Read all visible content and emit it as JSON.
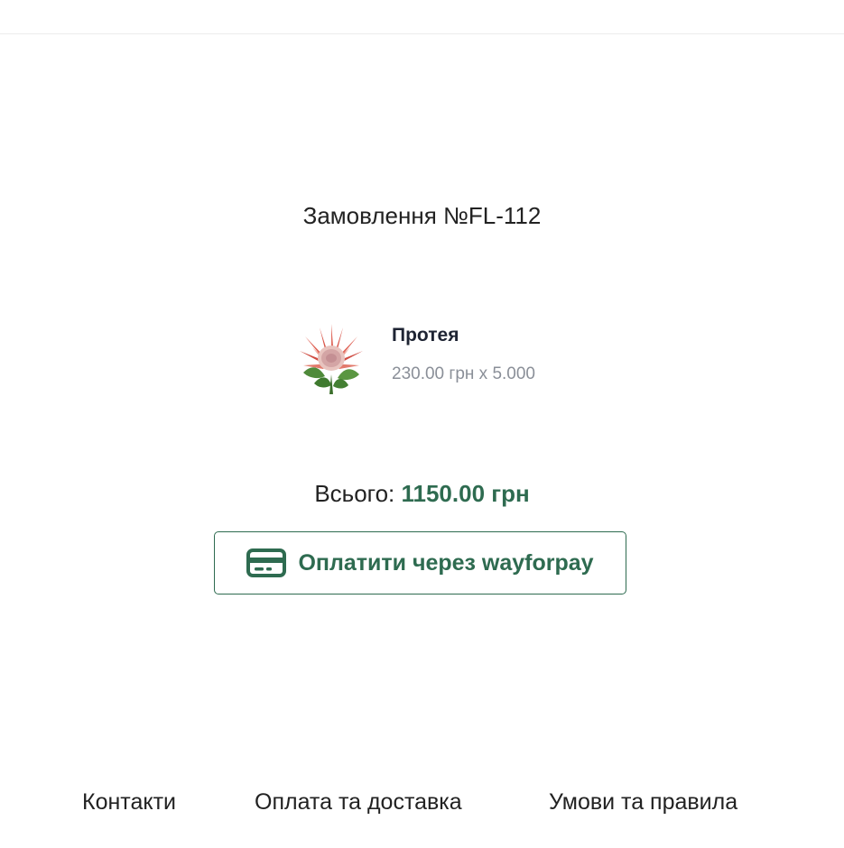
{
  "order": {
    "title": "Замовлення №FL-112"
  },
  "item": {
    "name": "Протея",
    "price_quantity": "230.00 грн x 5.000",
    "image_icon": "protea-flower"
  },
  "total": {
    "label": "Всього: ",
    "value": "1150.00 грн"
  },
  "payment": {
    "button_label": "Оплатити через wayforpay",
    "icon": "credit-card-icon"
  },
  "footer": {
    "links": [
      "Контакти",
      "Оплата та доставка",
      "Умови та правила"
    ]
  },
  "colors": {
    "accent": "#2e6b50",
    "muted_text": "#8a8f98",
    "item_name": "#1e2433"
  }
}
